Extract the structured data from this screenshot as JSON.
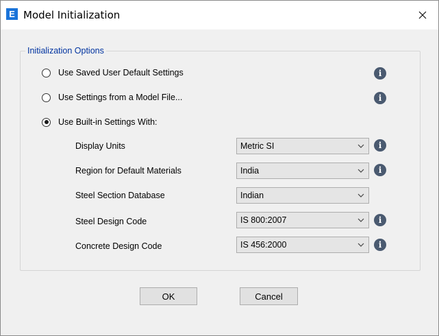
{
  "window": {
    "app_icon_letter": "E",
    "title": "Model Initialization",
    "close_glyph": "close-icon"
  },
  "group": {
    "label": "Initialization Options"
  },
  "options": [
    {
      "label": "Use Saved User Default Settings",
      "selected": false
    },
    {
      "label": "Use Settings from a Model File...",
      "selected": false
    },
    {
      "label": "Use Built-in Settings With:",
      "selected": true
    }
  ],
  "fields": {
    "display_units": {
      "label": "Display Units",
      "value": "Metric SI"
    },
    "region": {
      "label": "Region for Default Materials",
      "value": "India"
    },
    "steel_db": {
      "label": "Steel Section Database",
      "value": "Indian"
    },
    "steel_code": {
      "label": "Steel Design Code",
      "value": "IS 800:2007"
    },
    "concrete_code": {
      "label": "Concrete Design Code",
      "value": "IS 456:2000"
    }
  },
  "info_glyph": "i",
  "buttons": {
    "ok": "OK",
    "cancel": "Cancel"
  },
  "colors": {
    "app_icon": "#1a73d9",
    "group_label": "#0033a0",
    "info_icon": "#4a5a70",
    "dialog_bg": "#f0f0f0"
  }
}
